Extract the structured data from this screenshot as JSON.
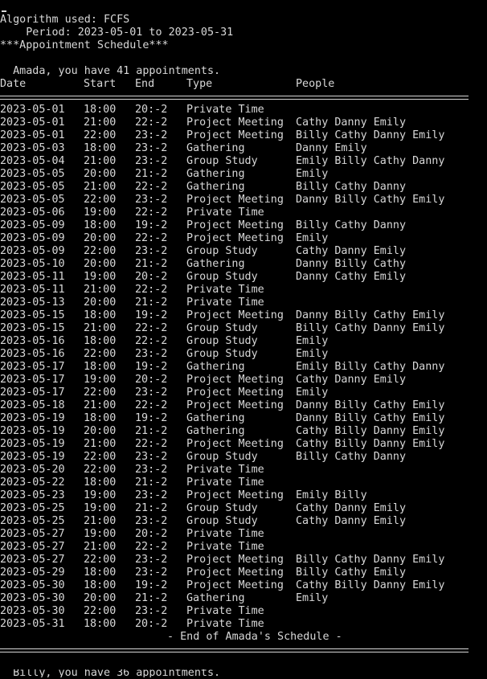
{
  "header": {
    "period": "Period: 2023-05-01 to 2023-05-31",
    "algorithm": "Algorithm used: FCFS",
    "schedule_title": "***Appointment Schedule***",
    "summary": "  Amada, you have 41 appointments."
  },
  "columns": {
    "date": "Date",
    "start": "Start",
    "end": "End",
    "type": "Type",
    "people": "People"
  },
  "rows": [
    {
      "date": "2023-05-01",
      "start": "18:00",
      "end": "20:-2",
      "type": "Private Time",
      "people": ""
    },
    {
      "date": "2023-05-01",
      "start": "21:00",
      "end": "22:-2",
      "type": "Project Meeting",
      "people": "Cathy Danny Emily"
    },
    {
      "date": "2023-05-01",
      "start": "22:00",
      "end": "23:-2",
      "type": "Project Meeting",
      "people": "Billy Cathy Danny Emily"
    },
    {
      "date": "2023-05-03",
      "start": "18:00",
      "end": "23:-2",
      "type": "Gathering",
      "people": "Danny Emily"
    },
    {
      "date": "2023-05-04",
      "start": "21:00",
      "end": "23:-2",
      "type": "Group Study",
      "people": "Emily Billy Cathy Danny"
    },
    {
      "date": "2023-05-05",
      "start": "20:00",
      "end": "21:-2",
      "type": "Gathering",
      "people": "Emily"
    },
    {
      "date": "2023-05-05",
      "start": "21:00",
      "end": "22:-2",
      "type": "Gathering",
      "people": "Billy Cathy Danny"
    },
    {
      "date": "2023-05-05",
      "start": "22:00",
      "end": "23:-2",
      "type": "Project Meeting",
      "people": "Danny Billy Cathy Emily"
    },
    {
      "date": "2023-05-06",
      "start": "19:00",
      "end": "22:-2",
      "type": "Private Time",
      "people": ""
    },
    {
      "date": "2023-05-09",
      "start": "18:00",
      "end": "19:-2",
      "type": "Project Meeting",
      "people": "Billy Cathy Danny"
    },
    {
      "date": "2023-05-09",
      "start": "20:00",
      "end": "22:-2",
      "type": "Project Meeting",
      "people": "Emily"
    },
    {
      "date": "2023-05-09",
      "start": "22:00",
      "end": "23:-2",
      "type": "Group Study",
      "people": "Cathy Danny Emily"
    },
    {
      "date": "2023-05-10",
      "start": "20:00",
      "end": "21:-2",
      "type": "Gathering",
      "people": "Danny Billy Cathy"
    },
    {
      "date": "2023-05-11",
      "start": "19:00",
      "end": "20:-2",
      "type": "Group Study",
      "people": "Danny Cathy Emily"
    },
    {
      "date": "2023-05-11",
      "start": "21:00",
      "end": "22:-2",
      "type": "Private Time",
      "people": ""
    },
    {
      "date": "2023-05-13",
      "start": "20:00",
      "end": "21:-2",
      "type": "Private Time",
      "people": ""
    },
    {
      "date": "2023-05-15",
      "start": "18:00",
      "end": "19:-2",
      "type": "Project Meeting",
      "people": "Danny Billy Cathy Emily"
    },
    {
      "date": "2023-05-15",
      "start": "21:00",
      "end": "22:-2",
      "type": "Group Study",
      "people": "Billy Cathy Danny Emily"
    },
    {
      "date": "2023-05-16",
      "start": "18:00",
      "end": "22:-2",
      "type": "Group Study",
      "people": "Emily"
    },
    {
      "date": "2023-05-16",
      "start": "22:00",
      "end": "23:-2",
      "type": "Group Study",
      "people": "Emily"
    },
    {
      "date": "2023-05-17",
      "start": "18:00",
      "end": "19:-2",
      "type": "Gathering",
      "people": "Emily Billy Cathy Danny"
    },
    {
      "date": "2023-05-17",
      "start": "19:00",
      "end": "20:-2",
      "type": "Project Meeting",
      "people": "Cathy Danny Emily"
    },
    {
      "date": "2023-05-17",
      "start": "22:00",
      "end": "23:-2",
      "type": "Project Meeting",
      "people": "Emily"
    },
    {
      "date": "2023-05-18",
      "start": "21:00",
      "end": "22:-2",
      "type": "Project Meeting",
      "people": "Danny Billy Cathy Emily"
    },
    {
      "date": "2023-05-19",
      "start": "18:00",
      "end": "19:-2",
      "type": "Gathering",
      "people": "Danny Billy Cathy Emily"
    },
    {
      "date": "2023-05-19",
      "start": "20:00",
      "end": "21:-2",
      "type": "Gathering",
      "people": "Cathy Billy Danny Emily"
    },
    {
      "date": "2023-05-19",
      "start": "21:00",
      "end": "22:-2",
      "type": "Project Meeting",
      "people": "Cathy Billy Danny Emily"
    },
    {
      "date": "2023-05-19",
      "start": "22:00",
      "end": "23:-2",
      "type": "Group Study",
      "people": "Billy Cathy Danny"
    },
    {
      "date": "2023-05-20",
      "start": "22:00",
      "end": "23:-2",
      "type": "Private Time",
      "people": ""
    },
    {
      "date": "2023-05-22",
      "start": "18:00",
      "end": "21:-2",
      "type": "Private Time",
      "people": ""
    },
    {
      "date": "2023-05-23",
      "start": "19:00",
      "end": "23:-2",
      "type": "Project Meeting",
      "people": "Emily Billy"
    },
    {
      "date": "2023-05-25",
      "start": "19:00",
      "end": "21:-2",
      "type": "Group Study",
      "people": "Cathy Danny Emily"
    },
    {
      "date": "2023-05-25",
      "start": "21:00",
      "end": "23:-2",
      "type": "Group Study",
      "people": "Cathy Danny Emily"
    },
    {
      "date": "2023-05-27",
      "start": "19:00",
      "end": "20:-2",
      "type": "Private Time",
      "people": ""
    },
    {
      "date": "2023-05-27",
      "start": "21:00",
      "end": "22:-2",
      "type": "Private Time",
      "people": ""
    },
    {
      "date": "2023-05-27",
      "start": "22:00",
      "end": "23:-2",
      "type": "Project Meeting",
      "people": "Billy Cathy Danny Emily"
    },
    {
      "date": "2023-05-29",
      "start": "18:00",
      "end": "23:-2",
      "type": "Project Meeting",
      "people": "Billy Cathy Emily"
    },
    {
      "date": "2023-05-30",
      "start": "18:00",
      "end": "19:-2",
      "type": "Project Meeting",
      "people": "Cathy Billy Danny Emily"
    },
    {
      "date": "2023-05-30",
      "start": "20:00",
      "end": "21:-2",
      "type": "Gathering",
      "people": "Emily"
    },
    {
      "date": "2023-05-30",
      "start": "22:00",
      "end": "23:-2",
      "type": "Private Time",
      "people": ""
    },
    {
      "date": "2023-05-31",
      "start": "18:00",
      "end": "20:-2",
      "type": "Private Time",
      "people": ""
    }
  ],
  "footer": {
    "end_text": "- End of Amada's Schedule -",
    "next_partial": "  Billy, you have 36 appointments."
  },
  "colors": {
    "background": "#000000",
    "text": "#d8d8d8"
  }
}
